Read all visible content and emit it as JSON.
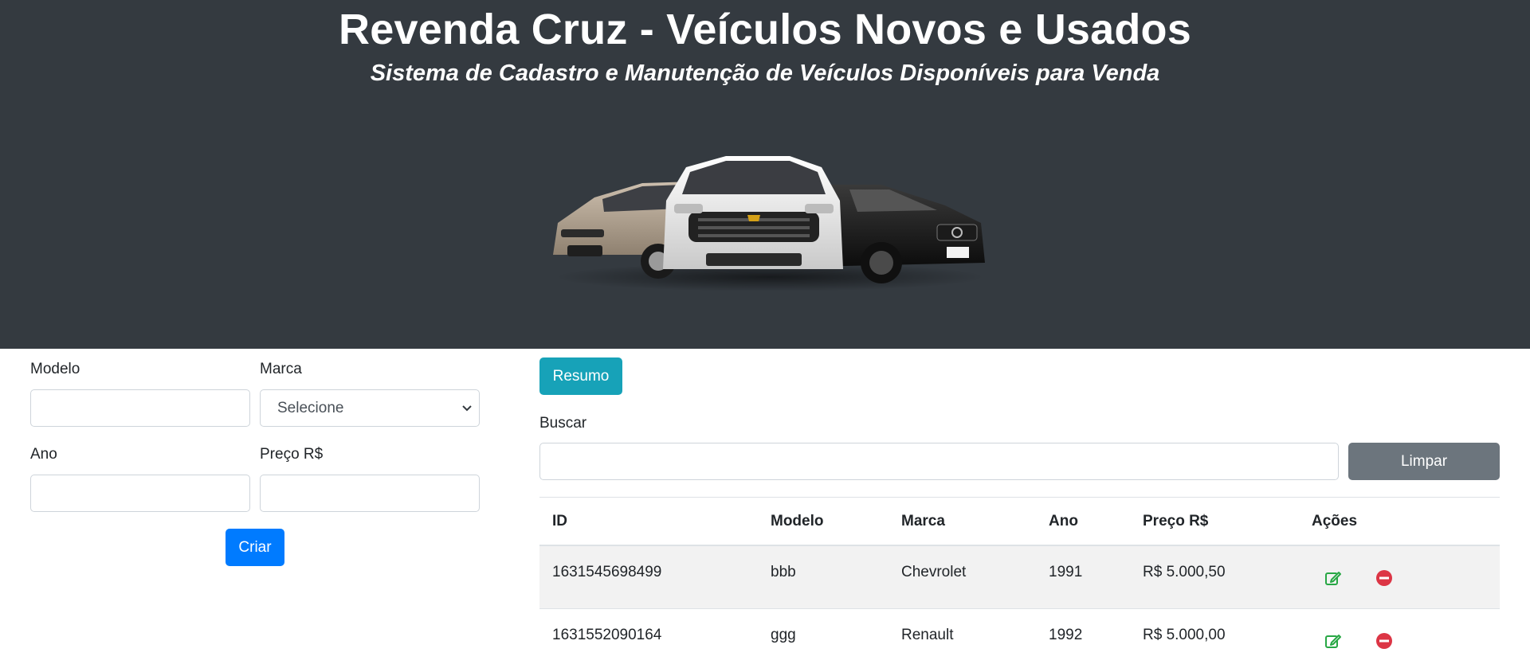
{
  "header": {
    "title": "Revenda Cruz - Veículos Novos e Usados",
    "subtitle": "Sistema de Cadastro e Manutenção de Veículos Disponíveis para Venda"
  },
  "form": {
    "modelo_label": "Modelo",
    "modelo_value": "",
    "marca_label": "Marca",
    "marca_selected": "Selecione",
    "ano_label": "Ano",
    "ano_value": "",
    "preco_label": "Preço R$",
    "preco_value": "",
    "criar_label": "Criar"
  },
  "toolbar": {
    "resumo_label": "Resumo",
    "buscar_label": "Buscar",
    "buscar_value": "",
    "limpar_label": "Limpar"
  },
  "table": {
    "columns": [
      "ID",
      "Modelo",
      "Marca",
      "Ano",
      "Preço R$",
      "Ações"
    ],
    "rows": [
      {
        "id": "1631545698499",
        "modelo": "bbb",
        "marca": "Chevrolet",
        "ano": "1991",
        "preco": "R$ 5.000,50"
      },
      {
        "id": "1631552090164",
        "modelo": "ggg",
        "marca": "Renault",
        "ano": "1992",
        "preco": "R$ 5.000,00"
      }
    ],
    "actions": {
      "edit_icon": "edit-icon",
      "delete_icon": "minus-circle-icon"
    }
  },
  "colors": {
    "header_bg": "#343a40",
    "primary": "#007bff",
    "info": "#17a2b8",
    "secondary": "#6c757d",
    "edit_green": "#28a745",
    "delete_red": "#dc3545"
  }
}
